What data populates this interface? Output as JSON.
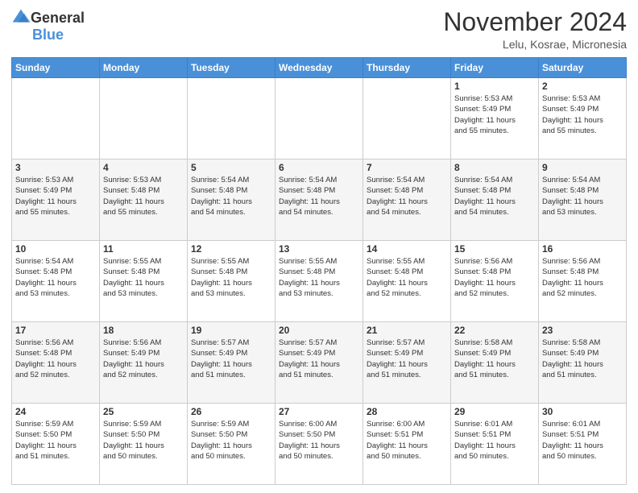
{
  "logo": {
    "general": "General",
    "blue": "Blue"
  },
  "title": "November 2024",
  "location": "Lelu, Kosrae, Micronesia",
  "weekdays": [
    "Sunday",
    "Monday",
    "Tuesday",
    "Wednesday",
    "Thursday",
    "Friday",
    "Saturday"
  ],
  "weeks": [
    [
      {
        "day": "",
        "info": ""
      },
      {
        "day": "",
        "info": ""
      },
      {
        "day": "",
        "info": ""
      },
      {
        "day": "",
        "info": ""
      },
      {
        "day": "",
        "info": ""
      },
      {
        "day": "1",
        "info": "Sunrise: 5:53 AM\nSunset: 5:49 PM\nDaylight: 11 hours\nand 55 minutes."
      },
      {
        "day": "2",
        "info": "Sunrise: 5:53 AM\nSunset: 5:49 PM\nDaylight: 11 hours\nand 55 minutes."
      }
    ],
    [
      {
        "day": "3",
        "info": "Sunrise: 5:53 AM\nSunset: 5:49 PM\nDaylight: 11 hours\nand 55 minutes."
      },
      {
        "day": "4",
        "info": "Sunrise: 5:53 AM\nSunset: 5:48 PM\nDaylight: 11 hours\nand 55 minutes."
      },
      {
        "day": "5",
        "info": "Sunrise: 5:54 AM\nSunset: 5:48 PM\nDaylight: 11 hours\nand 54 minutes."
      },
      {
        "day": "6",
        "info": "Sunrise: 5:54 AM\nSunset: 5:48 PM\nDaylight: 11 hours\nand 54 minutes."
      },
      {
        "day": "7",
        "info": "Sunrise: 5:54 AM\nSunset: 5:48 PM\nDaylight: 11 hours\nand 54 minutes."
      },
      {
        "day": "8",
        "info": "Sunrise: 5:54 AM\nSunset: 5:48 PM\nDaylight: 11 hours\nand 54 minutes."
      },
      {
        "day": "9",
        "info": "Sunrise: 5:54 AM\nSunset: 5:48 PM\nDaylight: 11 hours\nand 53 minutes."
      }
    ],
    [
      {
        "day": "10",
        "info": "Sunrise: 5:54 AM\nSunset: 5:48 PM\nDaylight: 11 hours\nand 53 minutes."
      },
      {
        "day": "11",
        "info": "Sunrise: 5:55 AM\nSunset: 5:48 PM\nDaylight: 11 hours\nand 53 minutes."
      },
      {
        "day": "12",
        "info": "Sunrise: 5:55 AM\nSunset: 5:48 PM\nDaylight: 11 hours\nand 53 minutes."
      },
      {
        "day": "13",
        "info": "Sunrise: 5:55 AM\nSunset: 5:48 PM\nDaylight: 11 hours\nand 53 minutes."
      },
      {
        "day": "14",
        "info": "Sunrise: 5:55 AM\nSunset: 5:48 PM\nDaylight: 11 hours\nand 52 minutes."
      },
      {
        "day": "15",
        "info": "Sunrise: 5:56 AM\nSunset: 5:48 PM\nDaylight: 11 hours\nand 52 minutes."
      },
      {
        "day": "16",
        "info": "Sunrise: 5:56 AM\nSunset: 5:48 PM\nDaylight: 11 hours\nand 52 minutes."
      }
    ],
    [
      {
        "day": "17",
        "info": "Sunrise: 5:56 AM\nSunset: 5:48 PM\nDaylight: 11 hours\nand 52 minutes."
      },
      {
        "day": "18",
        "info": "Sunrise: 5:56 AM\nSunset: 5:49 PM\nDaylight: 11 hours\nand 52 minutes."
      },
      {
        "day": "19",
        "info": "Sunrise: 5:57 AM\nSunset: 5:49 PM\nDaylight: 11 hours\nand 51 minutes."
      },
      {
        "day": "20",
        "info": "Sunrise: 5:57 AM\nSunset: 5:49 PM\nDaylight: 11 hours\nand 51 minutes."
      },
      {
        "day": "21",
        "info": "Sunrise: 5:57 AM\nSunset: 5:49 PM\nDaylight: 11 hours\nand 51 minutes."
      },
      {
        "day": "22",
        "info": "Sunrise: 5:58 AM\nSunset: 5:49 PM\nDaylight: 11 hours\nand 51 minutes."
      },
      {
        "day": "23",
        "info": "Sunrise: 5:58 AM\nSunset: 5:49 PM\nDaylight: 11 hours\nand 51 minutes."
      }
    ],
    [
      {
        "day": "24",
        "info": "Sunrise: 5:59 AM\nSunset: 5:50 PM\nDaylight: 11 hours\nand 51 minutes."
      },
      {
        "day": "25",
        "info": "Sunrise: 5:59 AM\nSunset: 5:50 PM\nDaylight: 11 hours\nand 50 minutes."
      },
      {
        "day": "26",
        "info": "Sunrise: 5:59 AM\nSunset: 5:50 PM\nDaylight: 11 hours\nand 50 minutes."
      },
      {
        "day": "27",
        "info": "Sunrise: 6:00 AM\nSunset: 5:50 PM\nDaylight: 11 hours\nand 50 minutes."
      },
      {
        "day": "28",
        "info": "Sunrise: 6:00 AM\nSunset: 5:51 PM\nDaylight: 11 hours\nand 50 minutes."
      },
      {
        "day": "29",
        "info": "Sunrise: 6:01 AM\nSunset: 5:51 PM\nDaylight: 11 hours\nand 50 minutes."
      },
      {
        "day": "30",
        "info": "Sunrise: 6:01 AM\nSunset: 5:51 PM\nDaylight: 11 hours\nand 50 minutes."
      }
    ]
  ]
}
